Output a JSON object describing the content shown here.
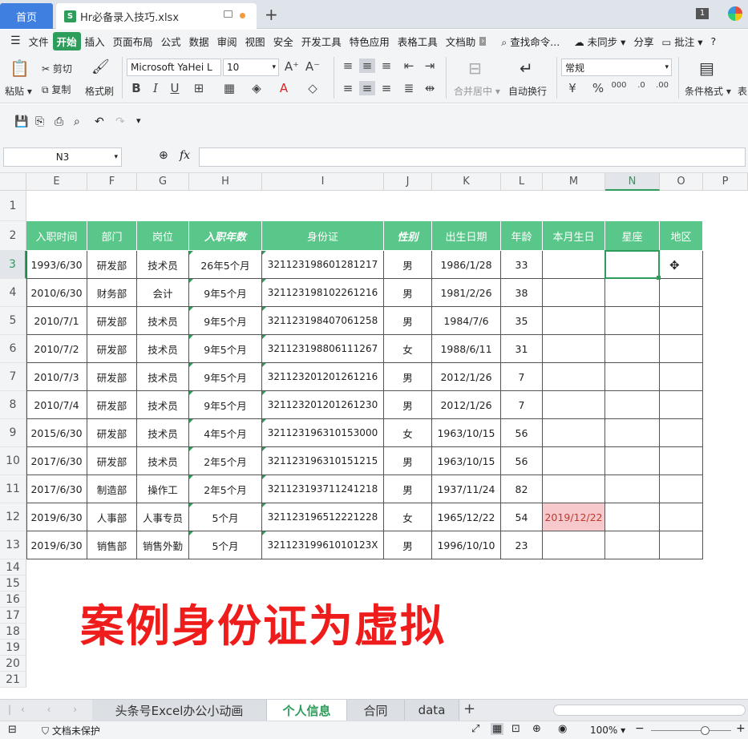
{
  "tabs": {
    "home": "首页",
    "file_name": "Hr必备录入技巧.xlsx",
    "file_icon": "S",
    "badge": "1"
  },
  "menu": [
    "文件",
    "开始",
    "插入",
    "页面布局",
    "公式",
    "数据",
    "审阅",
    "视图",
    "安全",
    "开发工具",
    "特色应用",
    "表格工具",
    "文档助"
  ],
  "menu_active": "开始",
  "menu_right": {
    "search": "查找命令...",
    "sync": "未同步",
    "share": "分享",
    "annotate": "批注"
  },
  "ribbon": {
    "paste": "粘贴",
    "cut": "剪切",
    "copy": "复制",
    "format_painter": "格式刷",
    "font_name": "Microsoft YaHei L",
    "font_size": "10",
    "merge": "合并居中",
    "wrap": "自动换行",
    "number_format": "常规",
    "cond_format": "条件格式",
    "table_style": "表"
  },
  "formula_bar": {
    "name_box": "N3",
    "fx": "fx",
    "value": ""
  },
  "columns": [
    "E",
    "F",
    "G",
    "H",
    "I",
    "J",
    "K",
    "L",
    "M",
    "N",
    "O",
    "P"
  ],
  "selected_column": "N",
  "selected_row": "3",
  "row_numbers": [
    "1",
    "2",
    "3",
    "4",
    "5",
    "6",
    "7",
    "8",
    "9",
    "10",
    "11",
    "12",
    "13",
    "14",
    "15",
    "16",
    "17",
    "18",
    "19",
    "20",
    "21"
  ],
  "table": {
    "headers": [
      "入职时间",
      "部门",
      "岗位",
      "入职年数",
      "身份证",
      "性别",
      "出生日期",
      "年龄",
      "本月生日",
      "星座",
      "地区"
    ],
    "rows": [
      [
        "1993/6/30",
        "研发部",
        "技术员",
        "26年5个月",
        "321123198601281217",
        "男",
        "1986/1/28",
        "33",
        "",
        "",
        ""
      ],
      [
        "2010/6/30",
        "财务部",
        "会计",
        "9年5个月",
        "321123198102261216",
        "男",
        "1981/2/26",
        "38",
        "",
        "",
        ""
      ],
      [
        "2010/7/1",
        "研发部",
        "技术员",
        "9年5个月",
        "321123198407061258",
        "男",
        "1984/7/6",
        "35",
        "",
        "",
        ""
      ],
      [
        "2010/7/2",
        "研发部",
        "技术员",
        "9年5个月",
        "321123198806111267",
        "女",
        "1988/6/11",
        "31",
        "",
        "",
        ""
      ],
      [
        "2010/7/3",
        "研发部",
        "技术员",
        "9年5个月",
        "321123201201261216",
        "男",
        "2012/1/26",
        "7",
        "",
        "",
        ""
      ],
      [
        "2010/7/4",
        "研发部",
        "技术员",
        "9年5个月",
        "321123201201261230",
        "男",
        "2012/1/26",
        "7",
        "",
        "",
        ""
      ],
      [
        "2015/6/30",
        "研发部",
        "技术员",
        "4年5个月",
        "321123196310153000",
        "女",
        "1963/10/15",
        "56",
        "",
        "",
        ""
      ],
      [
        "2017/6/30",
        "研发部",
        "技术员",
        "2年5个月",
        "321123196310151215",
        "男",
        "1963/10/15",
        "56",
        "",
        "",
        ""
      ],
      [
        "2017/6/30",
        "制造部",
        "操作工",
        "2年5个月",
        "321123193711241218",
        "男",
        "1937/11/24",
        "82",
        "",
        "",
        ""
      ],
      [
        "2019/6/30",
        "人事部",
        "人事专员",
        "5个月",
        "321123196512221228",
        "女",
        "1965/12/22",
        "54",
        "2019/12/22",
        "",
        ""
      ],
      [
        "2019/6/30",
        "销售部",
        "销售外勤",
        "5个月",
        "32112319961010123X",
        "男",
        "1996/10/10",
        "23",
        "",
        "",
        ""
      ]
    ]
  },
  "overlay_text": "案例身份证为虚拟",
  "sheets": [
    "头条号Excel办公小动画",
    "个人信息",
    "合同",
    "data"
  ],
  "active_sheet": "个人信息",
  "status": {
    "protect": "文档未保护",
    "zoom": "100%"
  },
  "colors": {
    "accent": "#2e9c5a",
    "header_green": "#59c789",
    "birthday_highlight": "#f8c9cc",
    "overlay_red": "#ef1c1c"
  }
}
